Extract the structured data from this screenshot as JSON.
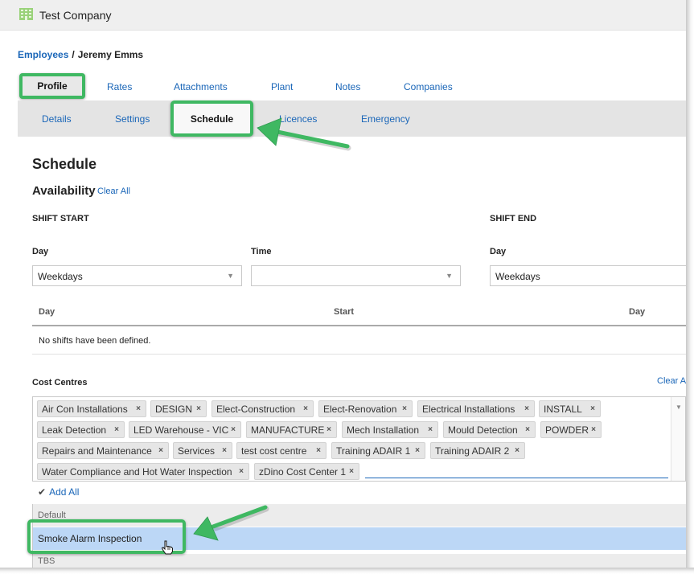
{
  "app": {
    "company_name": "Test Company",
    "icon": "building-icon"
  },
  "breadcrumb": {
    "parent": "Employees",
    "separator": "/",
    "current": "Jeremy Emms"
  },
  "tabs": {
    "profile": "Profile",
    "rates": "Rates",
    "attachments": "Attachments",
    "plant": "Plant",
    "notes": "Notes",
    "companies": "Companies"
  },
  "subtabs": {
    "details": "Details",
    "settings": "Settings",
    "schedule": "Schedule",
    "licences": "Licences",
    "emergency": "Emergency"
  },
  "schedule": {
    "title": "Schedule",
    "availability_title": "Availability",
    "clear_all": "Clear All",
    "shift_start": "SHIFT START",
    "shift_end": "SHIFT END",
    "day_label": "Day",
    "time_label": "Time",
    "start_day_value": "Weekdays",
    "start_time_value": "",
    "end_day_label": "Day",
    "end_day_value": "Weekdays"
  },
  "shifts_table": {
    "columns": [
      "Day",
      "Start",
      "Day"
    ],
    "empty_message": "No shifts have been defined."
  },
  "cost_centres": {
    "label": "Cost Centres",
    "clear_all": "Clear A",
    "selected": [
      "Air Con Installations",
      "DESIGN",
      "Elect-Construction",
      "Elect-Renovation",
      "Electrical Installations",
      "INSTALL",
      "Leak Detection",
      "LED Warehouse - VIC",
      "MANUFACTURE",
      "Mech Installation",
      "Mould Detection",
      "POWDER",
      "Repairs and Maintenance",
      "Services",
      "test cost centre",
      "Training ADAIR 1",
      "Training ADAIR 2",
      "Water Compliance and Hot Water Inspection",
      "zDino Cost Center 1"
    ],
    "remove_glyph": "×",
    "add_all": "Add All",
    "dropdown": {
      "group_default": "Default",
      "highlighted_option": "Smoke Alarm Inspection",
      "group_tbs": "TBS"
    }
  },
  "colors": {
    "highlight_green": "#3fb862",
    "link_blue": "#1a66b8",
    "option_highlight": "#bcd7f6"
  }
}
